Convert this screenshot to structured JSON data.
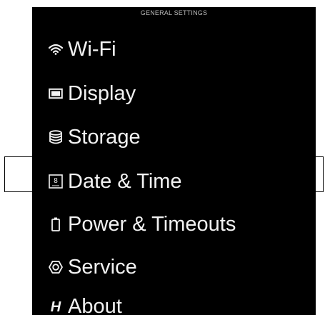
{
  "screen": {
    "title": "GENERAL SETTINGS"
  },
  "menu": {
    "items": [
      {
        "label": "Wi-Fi",
        "icon": "wifi-icon"
      },
      {
        "label": "Display",
        "icon": "display-icon"
      },
      {
        "label": "Storage",
        "icon": "storage-icon"
      },
      {
        "label": "Date & Time",
        "icon": "calendar-icon",
        "icon_text": "8",
        "selected": true
      },
      {
        "label": "Power & Timeouts",
        "icon": "battery-icon"
      },
      {
        "label": "Service",
        "icon": "service-icon"
      },
      {
        "label": "About",
        "icon": "brand-h-icon",
        "icon_text": "H"
      }
    ]
  },
  "colors": {
    "background": "#000000",
    "text": "#f2f2f2",
    "title": "#b9b9b9",
    "selection_border": "#000000"
  }
}
